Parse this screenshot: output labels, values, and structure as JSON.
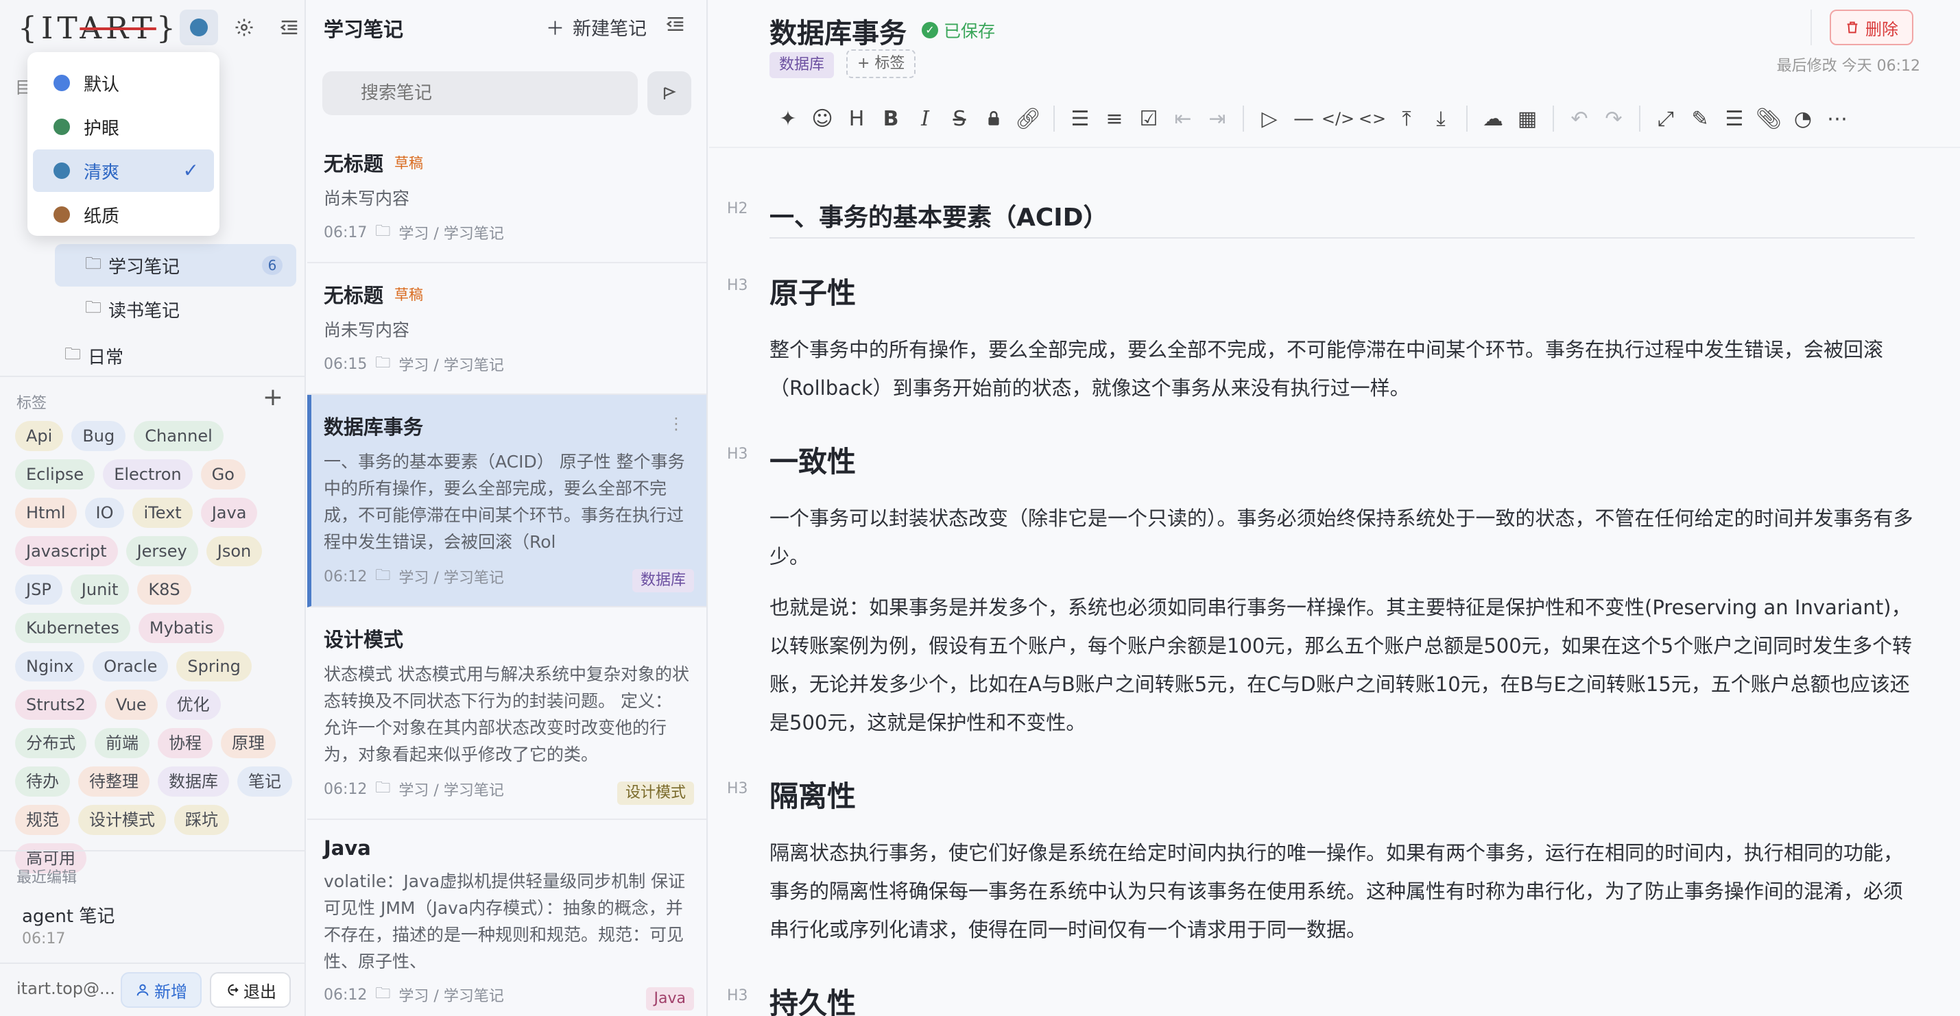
{
  "sidebar": {
    "logo": "{IT ART}",
    "tree_letter": "目",
    "folders": [
      {
        "label": "学习笔记",
        "count": "6"
      },
      {
        "label": "读书笔记"
      },
      {
        "label": "日常"
      }
    ],
    "tags_title": "标签",
    "tags": [
      {
        "label": "Api",
        "color": "#f1ecd8"
      },
      {
        "label": "Bug",
        "color": "#e3eaf6"
      },
      {
        "label": "Channel",
        "color": "#e2efe6"
      },
      {
        "label": "Eclipse",
        "color": "#e2efe6"
      },
      {
        "label": "Electron",
        "color": "#ece7f5"
      },
      {
        "label": "Go",
        "color": "#f7e6de"
      },
      {
        "label": "Html",
        "color": "#f7e6de"
      },
      {
        "label": "IO",
        "color": "#e3eaf6"
      },
      {
        "label": "iText",
        "color": "#f1ecd8"
      },
      {
        "label": "Java",
        "color": "#f4e1ea"
      },
      {
        "label": "Javascript",
        "color": "#f4e1ea"
      },
      {
        "label": "Jersey",
        "color": "#e2efe6"
      },
      {
        "label": "Json",
        "color": "#f1ecd8"
      },
      {
        "label": "JSP",
        "color": "#e3eaf6"
      },
      {
        "label": "Junit",
        "color": "#e2efe6"
      },
      {
        "label": "K8S",
        "color": "#f7e6de"
      },
      {
        "label": "Kubernetes",
        "color": "#e2efe6"
      },
      {
        "label": "Mybatis",
        "color": "#f4e1ea"
      },
      {
        "label": "Nginx",
        "color": "#e3eaf6"
      },
      {
        "label": "Oracle",
        "color": "#e3eaf6"
      },
      {
        "label": "Spring",
        "color": "#f1ecd8"
      },
      {
        "label": "Struts2",
        "color": "#f4e1ea"
      },
      {
        "label": "Vue",
        "color": "#f7e6de"
      },
      {
        "label": "优化",
        "color": "#ece7f5"
      },
      {
        "label": "分布式",
        "color": "#e2efe6"
      },
      {
        "label": "前端",
        "color": "#e2efe6"
      },
      {
        "label": "协程",
        "color": "#f4e1ea"
      },
      {
        "label": "原理",
        "color": "#f7e6de"
      },
      {
        "label": "待办",
        "color": "#e2efe6"
      },
      {
        "label": "待整理",
        "color": "#f7e6de"
      },
      {
        "label": "数据库",
        "color": "#ece7f5"
      },
      {
        "label": "笔记",
        "color": "#e3eaf6"
      },
      {
        "label": "规范",
        "color": "#f7e6de"
      },
      {
        "label": "设计模式",
        "color": "#f1ecd8"
      },
      {
        "label": "踩坑",
        "color": "#f1ecd8"
      },
      {
        "label": "高可用",
        "color": "#f4e1ea"
      }
    ],
    "recent_title": "最近编辑",
    "recent": {
      "title": "agent 笔记",
      "time": "06:17"
    },
    "email": "itart.top@...",
    "new_label": "新增",
    "exit_label": "退出"
  },
  "theme_menu": {
    "items": [
      {
        "label": "默认",
        "color": "#4a7fe0"
      },
      {
        "label": "护眼",
        "color": "#3f8a5c"
      },
      {
        "label": "清爽",
        "color": "#3d7eb0",
        "selected": true
      },
      {
        "label": "纸质",
        "color": "#a0683a"
      }
    ]
  },
  "note_list": {
    "title": "学习笔记",
    "new_label": "新建笔记",
    "search_placeholder": "搜索笔记",
    "notes": [
      {
        "title": "无标题",
        "badge": "草稿",
        "body": "尚未写内容",
        "time": "06:17",
        "path": "学习 / 学习笔记"
      },
      {
        "title": "无标题",
        "badge": "草稿",
        "body": "尚未写内容",
        "time": "06:15",
        "path": "学习 / 学习笔记"
      },
      {
        "title": "数据库事务",
        "body": "一、事务的基本要素（ACID） 原子性 整个事务中的所有操作，要么全部完成，要么全部不完成，不可能停滞在中间某个环节。事务在执行过程中发生错误，会被回滚（Rol",
        "time": "06:12",
        "path": "学习 / 学习笔记",
        "tag": "数据库",
        "tag_color": "#e8e2f3",
        "tag_text": "#6b4fa0"
      },
      {
        "title": "设计模式",
        "body": "状态模式 状态模式用与解决系统中复杂对象的状态转换及不同状态下行为的封装问题。 定义： 允许一个对象在其内部状态改变时改变他的行为，对象看起来似乎修改了它的类。",
        "time": "06:12",
        "path": "学习 / 学习笔记",
        "tag": "设计模式",
        "tag_color": "#f1ecd8",
        "tag_text": "#7a6a2a"
      },
      {
        "title": "Java",
        "body": "volatile：Java虚拟机提供轻量级同步机制 保证可见性 JMM（Java内存模式）：抽象的概念，并不存在，描述的是一种规则和规范。规范：可见性、原子性、",
        "time": "06:12",
        "path": "学习 / 学习笔记",
        "tag": "Java",
        "tag_color": "#f4e1ea",
        "tag_text": "#a0406a"
      }
    ]
  },
  "editor": {
    "title": "数据库事务",
    "saved": "已保存",
    "topic_tag": "数据库",
    "add_tag": "+ 标签",
    "delete_label": "删除",
    "last_modified": "最后修改 今天 06:12",
    "marks": {
      "h2": "H2",
      "h3": "H3"
    },
    "h2": "一、事务的基本要素（ACID）",
    "sections": [
      {
        "heading": "原子性",
        "paras": [
          "整个事务中的所有操作，要么全部完成，要么全部不完成，不可能停滞在中间某个环节。事务在执行过程中发生错误，会被回滚（Rollback）到事务开始前的状态，就像这个事务从来没有执行过一样。"
        ]
      },
      {
        "heading": "一致性",
        "paras": [
          "一个事务可以封装状态改变（除非它是一个只读的）。事务必须始终保持系统处于一致的状态，不管在任何给定的时间并发事务有多少。",
          "也就是说：如果事务是并发多个，系统也必须如同串行事务一样操作。其主要特征是保护性和不变性(Preserving an Invariant)，以转账案例为例，假设有五个账户，每个账户余额是100元，那么五个账户总额是500元，如果在这个5个账户之间同时发生多个转账，无论并发多少个，比如在A与B账户之间转账5元，在C与D账户之间转账10元，在B与E之间转账15元，五个账户总额也应该还是500元，这就是保护性和不变性。"
        ]
      },
      {
        "heading": "隔离性",
        "paras": [
          "隔离状态执行事务，使它们好像是系统在给定时间内执行的唯一操作。如果有两个事务，运行在相同的时间内，执行相同的功能，事务的隔离性将确保每一事务在系统中认为只有该事务在使用系统。这种属性有时称为串行化，为了防止事务操作间的混淆，必须串行化或序列化请求，使得在同一时间仅有一个请求用于同一数据。"
        ]
      },
      {
        "heading": "持久性",
        "paras": []
      }
    ]
  }
}
